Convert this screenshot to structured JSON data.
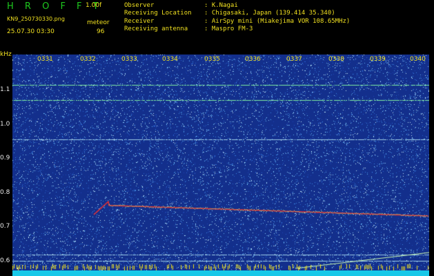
{
  "header": {
    "logo": "H R O F F T",
    "version": "1.00f",
    "filename": "KN9_250730330.png",
    "mode": "meteor",
    "datetime": "25.07.30 03:30",
    "count": "96",
    "info": [
      {
        "label": "Observer",
        "value": "K.Nagai"
      },
      {
        "label": "Receiving Location",
        "value": "Chigasaki, Japan (139.414 35.340)"
      },
      {
        "label": "Receiver",
        "value": "AirSpy mini (Miakejima VOR 108.65MHz)"
      },
      {
        "label": "Receiving antenna",
        "value": "Maspro FM-3"
      }
    ]
  },
  "spectrogram": {
    "y_unit": "kHz",
    "y_ticks": [
      "1.1",
      "1.0",
      "0.9",
      "0.8",
      "0.7",
      "0.6"
    ],
    "x_ticks": [
      "0331",
      "0332",
      "0333",
      "0334",
      "0335",
      "0336",
      "0337",
      "0338",
      "0339",
      "0340"
    ],
    "colors": {
      "background": "#132f8c",
      "noise": "#3fa0e0",
      "signal": "#e83030",
      "carrier": "#7ff0a0",
      "baseline": "#17c8e8"
    }
  }
}
